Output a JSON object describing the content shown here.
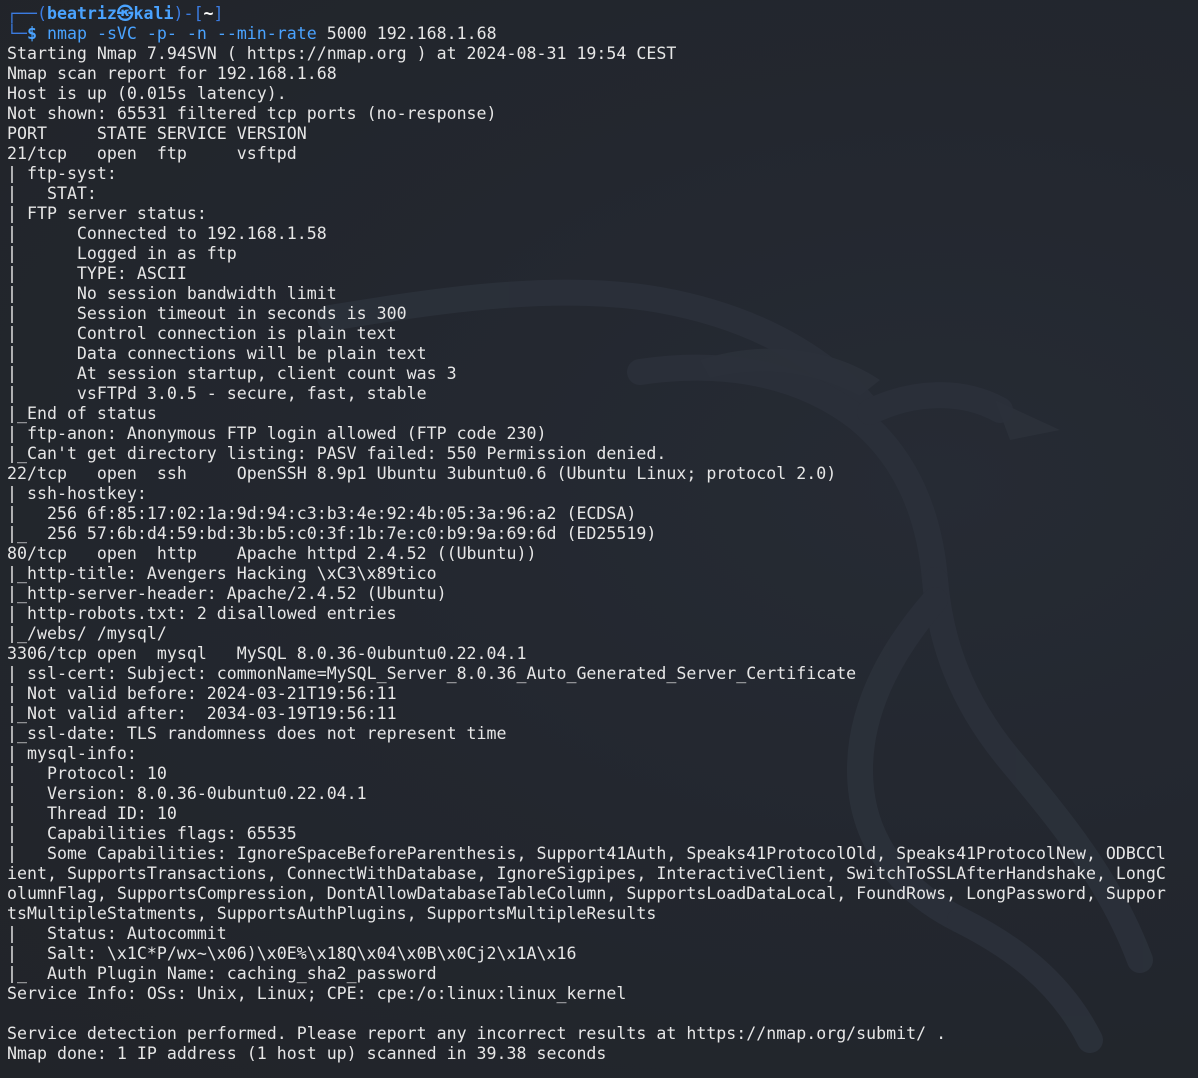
{
  "prompt": {
    "open": "┌──(",
    "user": "beatriz",
    "at_symbol": "㉿",
    "host": "kali",
    "mid": ")-[",
    "dir": "~",
    "close": "]",
    "second_line_prefix": "└─",
    "dollar": "$"
  },
  "command": {
    "name": "nmap",
    "flags": "-sVC -p- -n --min-rate",
    "args": "5000 192.168.1.68"
  },
  "output_lines": [
    "Starting Nmap 7.94SVN ( https://nmap.org ) at 2024-08-31 19:54 CEST",
    "Nmap scan report for 192.168.1.68",
    "Host is up (0.015s latency).",
    "Not shown: 65531 filtered tcp ports (no-response)",
    "PORT     STATE SERVICE VERSION",
    "21/tcp   open  ftp     vsftpd",
    "| ftp-syst:",
    "|   STAT:",
    "| FTP server status:",
    "|      Connected to 192.168.1.58",
    "|      Logged in as ftp",
    "|      TYPE: ASCII",
    "|      No session bandwidth limit",
    "|      Session timeout in seconds is 300",
    "|      Control connection is plain text",
    "|      Data connections will be plain text",
    "|      At session startup, client count was 3",
    "|      vsFTPd 3.0.5 - secure, fast, stable",
    "|_End of status",
    "| ftp-anon: Anonymous FTP login allowed (FTP code 230)",
    "|_Can't get directory listing: PASV failed: 550 Permission denied.",
    "22/tcp   open  ssh     OpenSSH 8.9p1 Ubuntu 3ubuntu0.6 (Ubuntu Linux; protocol 2.0)",
    "| ssh-hostkey:",
    "|   256 6f:85:17:02:1a:9d:94:c3:b3:4e:92:4b:05:3a:96:a2 (ECDSA)",
    "|_  256 57:6b:d4:59:bd:3b:b5:c0:3f:1b:7e:c0:b9:9a:69:6d (ED25519)",
    "80/tcp   open  http    Apache httpd 2.4.52 ((Ubuntu))",
    "|_http-title: Avengers Hacking \\xC3\\x89tico",
    "|_http-server-header: Apache/2.4.52 (Ubuntu)",
    "| http-robots.txt: 2 disallowed entries",
    "|_/webs/ /mysql/",
    "3306/tcp open  mysql   MySQL 8.0.36-0ubuntu0.22.04.1",
    "| ssl-cert: Subject: commonName=MySQL_Server_8.0.36_Auto_Generated_Server_Certificate",
    "| Not valid before: 2024-03-21T19:56:11",
    "|_Not valid after:  2034-03-19T19:56:11",
    "|_ssl-date: TLS randomness does not represent time",
    "| mysql-info:",
    "|   Protocol: 10",
    "|   Version: 8.0.36-0ubuntu0.22.04.1",
    "|   Thread ID: 10",
    "|   Capabilities flags: 65535",
    "|   Some Capabilities: IgnoreSpaceBeforeParenthesis, Support41Auth, Speaks41ProtocolOld, Speaks41ProtocolNew, ODBCCl",
    "ient, SupportsTransactions, ConnectWithDatabase, IgnoreSigpipes, InteractiveClient, SwitchToSSLAfterHandshake, LongC",
    "olumnFlag, SupportsCompression, DontAllowDatabaseTableColumn, SupportsLoadDataLocal, FoundRows, LongPassword, Suppor",
    "tsMultipleStatments, SupportsAuthPlugins, SupportsMultipleResults",
    "|   Status: Autocommit",
    "|   Salt: \\x1C*P/wx~\\x06)\\x0E%\\x18Q\\x04\\x0B\\x0Cj2\\x1A\\x16",
    "|_  Auth Plugin Name: caching_sha2_password",
    "Service Info: OSs: Unix, Linux; CPE: cpe:/o:linux:linux_kernel",
    "",
    "Service detection performed. Please report any incorrect results at https://nmap.org/submit/ .",
    "Nmap done: 1 IP address (1 host up) scanned in 39.38 seconds"
  ],
  "colors": {
    "background": "#22262e",
    "foreground": "#e6e6e6",
    "prompt_blue": "#4aa3ff",
    "frame_blue": "#3b7be0"
  },
  "background_logo": "kali-dragon-icon"
}
